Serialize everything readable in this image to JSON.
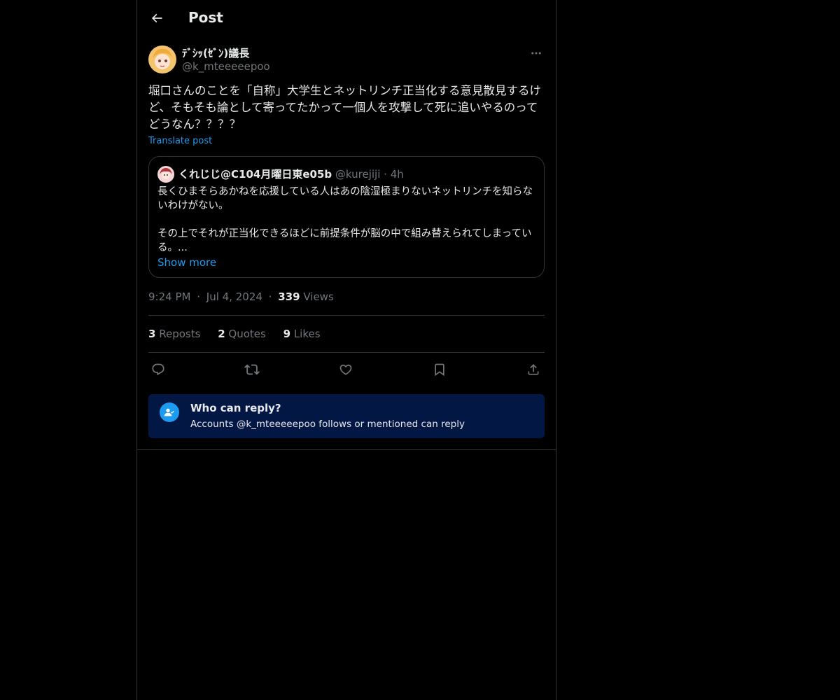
{
  "header": {
    "title": "Post"
  },
  "post": {
    "author_name": "ﾃﾞｼｯ(ｾﾞﾝ)議長",
    "author_handle": "@k_mteeeeepoo",
    "text": "堀口さんのことを「自称」大学生とネットリンチ正当化する意見散見するけど、そもそも論として寄ってたかって一個人を攻撃して死に追いやるのってどうなん？？？？",
    "translate_label": "Translate post",
    "time": "9:24 PM",
    "date": "Jul 4, 2024",
    "views_count": "339",
    "views_label": "Views",
    "separator": "·"
  },
  "quote": {
    "name": "くれじじ@C104月曜日東e05b",
    "handle": "@kurejiji",
    "separator": "·",
    "time": "4h",
    "text": "長くひまそらあかねを応援している人はあの陰湿極まりないネットリンチを知らないわけがない。\n\nその上でそれが正当化できるほどに前提条件が脳の中で組み替えられてしまっている。...",
    "show_more": "Show more"
  },
  "stats": {
    "reposts_count": "3",
    "reposts_label": "Reposts",
    "quotes_count": "2",
    "quotes_label": "Quotes",
    "likes_count": "9",
    "likes_label": "Likes"
  },
  "actions": {
    "icons": [
      "reply-icon",
      "repost-icon",
      "like-icon",
      "bookmark-icon",
      "share-icon"
    ]
  },
  "who_can_reply": {
    "title": "Who can reply?",
    "subtitle": "Accounts @k_mteeeeepoo follows or mentioned can reply"
  },
  "colors": {
    "background": "#000000",
    "text_primary": "#e7e9ea",
    "text_secondary": "#71767b",
    "accent": "#1d9bf0",
    "border": "#2f3336",
    "reply_banner": "#031745"
  }
}
